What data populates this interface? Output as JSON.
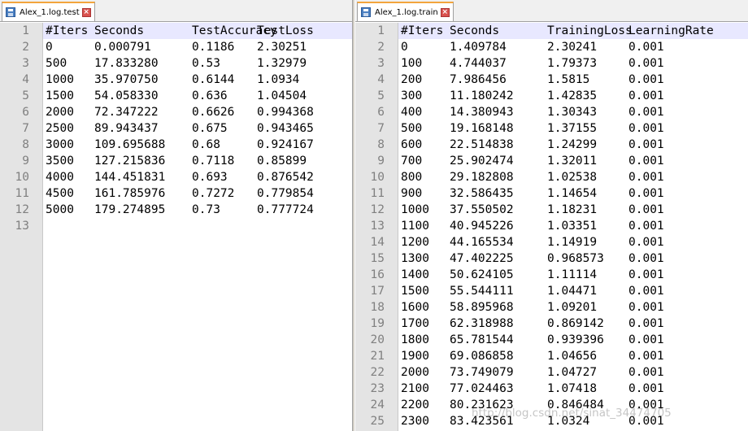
{
  "left_tab": {
    "title": "Alex_1.log.test"
  },
  "right_tab": {
    "title": "Alex_1.log.train"
  },
  "left_lines": [
    [
      "#Iters",
      "Seconds",
      "TestAccuracy",
      "TestLoss"
    ],
    [
      "0",
      "0.000791",
      "0.1186",
      "2.30251"
    ],
    [
      "500",
      "17.833280",
      "0.53",
      "1.32979"
    ],
    [
      "1000",
      "35.970750",
      "0.6144",
      "1.0934"
    ],
    [
      "1500",
      "54.058330",
      "0.636",
      "1.04504"
    ],
    [
      "2000",
      "72.347222",
      "0.6626",
      "0.994368"
    ],
    [
      "2500",
      "89.943437",
      "0.675",
      "0.943465"
    ],
    [
      "3000",
      "109.695688",
      "0.68",
      "0.924167"
    ],
    [
      "3500",
      "127.215836",
      "0.7118",
      "0.85899"
    ],
    [
      "4000",
      "144.451831",
      "0.693",
      "0.876542"
    ],
    [
      "4500",
      "161.785976",
      "0.7272",
      "0.779854"
    ],
    [
      "5000",
      "179.274895",
      "0.73",
      "0.777724"
    ],
    [
      "",
      "",
      "",
      ""
    ]
  ],
  "right_lines": [
    [
      "#Iters",
      "Seconds",
      "TrainingLoss",
      "LearningRate"
    ],
    [
      "0",
      "1.409784",
      "2.30241",
      "0.001"
    ],
    [
      "100",
      "4.744037",
      "1.79373",
      "0.001"
    ],
    [
      "200",
      "7.986456",
      "1.5815",
      "0.001"
    ],
    [
      "300",
      "11.180242",
      "1.42835",
      "0.001"
    ],
    [
      "400",
      "14.380943",
      "1.30343",
      "0.001"
    ],
    [
      "500",
      "19.168148",
      "1.37155",
      "0.001"
    ],
    [
      "600",
      "22.514838",
      "1.24299",
      "0.001"
    ],
    [
      "700",
      "25.902474",
      "1.32011",
      "0.001"
    ],
    [
      "800",
      "29.182808",
      "1.02538",
      "0.001"
    ],
    [
      "900",
      "32.586435",
      "1.14654",
      "0.001"
    ],
    [
      "1000",
      "37.550502",
      "1.18231",
      "0.001"
    ],
    [
      "1100",
      "40.945226",
      "1.03351",
      "0.001"
    ],
    [
      "1200",
      "44.165534",
      "1.14919",
      "0.001"
    ],
    [
      "1300",
      "47.402225",
      "0.968573",
      "0.001"
    ],
    [
      "1400",
      "50.624105",
      "1.11114",
      "0.001"
    ],
    [
      "1500",
      "55.544111",
      "1.04471",
      "0.001"
    ],
    [
      "1600",
      "58.895968",
      "1.09201",
      "0.001"
    ],
    [
      "1700",
      "62.318988",
      "0.869142",
      "0.001"
    ],
    [
      "1800",
      "65.781544",
      "0.939396",
      "0.001"
    ],
    [
      "1900",
      "69.086858",
      "1.04656",
      "0.001"
    ],
    [
      "2000",
      "73.749079",
      "1.04727",
      "0.001"
    ],
    [
      "2100",
      "77.024463",
      "1.07418",
      "0.001"
    ],
    [
      "2200",
      "80.231623",
      "0.846484",
      "0.001"
    ],
    [
      "2300",
      "83.423561",
      "1.0324",
      "0.001"
    ]
  ],
  "watermark": "http://blog.csdn.net/sinat_34474705"
}
